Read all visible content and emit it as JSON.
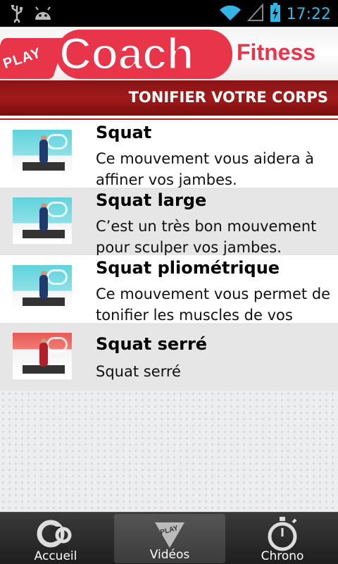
{
  "status_bar": {
    "time": "17:22",
    "icons": [
      "usb-icon",
      "android-debug-icon",
      "wifi-icon",
      "signal-icon",
      "battery-charging-icon"
    ]
  },
  "header": {
    "brand_play": "PLAY",
    "brand_coach": "Coach",
    "brand_fitness": "Fitness",
    "section_title": "TONIFIER VOTRE CORPS",
    "accent_color": "#e8354a"
  },
  "videos": [
    {
      "title": "Squat",
      "description": "Ce mouvement vous aidera à affiner vos jambes."
    },
    {
      "title": "Squat large",
      "description": "C’est un très bon mouvement pour sculper vos jambes."
    },
    {
      "title": "Squat pliométrique",
      "description": "Ce mouvement vous permet de tonifier les muscles de vos"
    },
    {
      "title": "Squat serré",
      "description": "Squat serré"
    }
  ],
  "tabs": [
    {
      "label": "Accueil",
      "icon": "home-logo-icon",
      "active": false
    },
    {
      "label": "Vidéos",
      "icon": "play-video-icon",
      "active": true
    },
    {
      "label": "Chrono",
      "icon": "stopwatch-icon",
      "active": false
    }
  ]
}
